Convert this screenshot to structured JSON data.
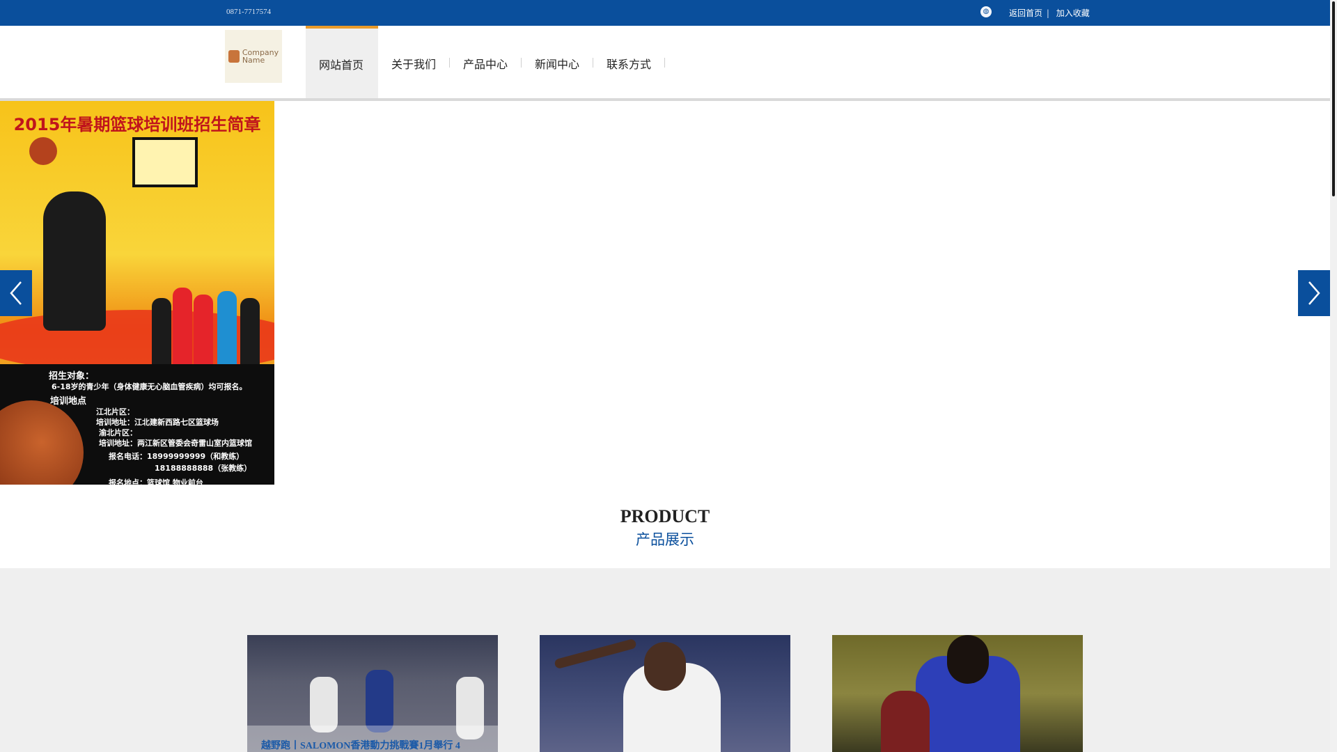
{
  "topbar": {
    "phone": "0871-7717574",
    "links": [
      "返回首页",
      "加入收藏"
    ],
    "separator": "|"
  },
  "logo": {
    "line1": "Company",
    "line2": "Name"
  },
  "nav": {
    "items": [
      {
        "label": "网站首页",
        "active": true
      },
      {
        "label": "关于我们"
      },
      {
        "label": "产品中心"
      },
      {
        "label": "新闻中心"
      },
      {
        "label": "联系方式"
      }
    ]
  },
  "banner": {
    "poster_title": "2015年暑期篮球培训班招生简章",
    "poster_lines": [
      "招生对象：",
      "6-18岁的青少年（身体健康无心脑血管疾病）均可报名。",
      "培训地点",
      "江北片区：",
      "培训地址：江北建新西路七区篮球场",
      "渝北片区：",
      "培训地址：两江新区管委会奇雷山室内篮球馆",
      "报名电话：18999999999（和教练）",
      "18188888888（张教练）",
      "报名地点：篮球馆   物业前台"
    ]
  },
  "product_section": {
    "title_en": "PRODUCT",
    "title_cn": "产品展示",
    "cards": [
      {
        "caption": "越野跑丨SALOMON香港動力挑戰賽1月舉行    4"
      },
      {
        "caption": ""
      },
      {
        "caption": ""
      }
    ]
  },
  "colors": {
    "brand_blue": "#0a4f9c",
    "nav_active_accent": "#e89a2a",
    "section_bg": "#efefef"
  }
}
